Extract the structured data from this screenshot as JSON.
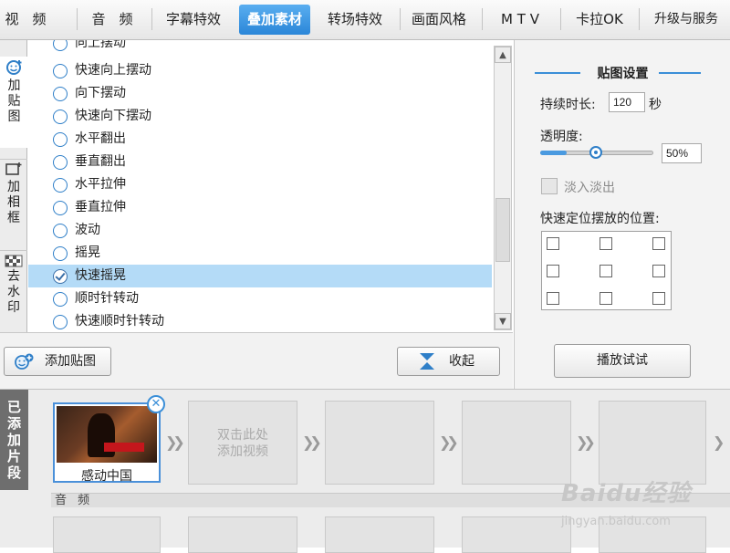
{
  "topnav": {
    "tabs": [
      {
        "label": "视　频"
      },
      {
        "label": "音　频"
      },
      {
        "label": "字幕特效"
      },
      {
        "label": "叠加素材"
      },
      {
        "label": "转场特效"
      },
      {
        "label": "画面风格"
      },
      {
        "label": "M T V"
      },
      {
        "label": "卡拉OK"
      },
      {
        "label": "升级与服务"
      }
    ],
    "active_tab": "叠加素材"
  },
  "sidebar": {
    "items": [
      {
        "label": "加贴图",
        "icon": "sticker-icon",
        "active": true
      },
      {
        "label": "加相框",
        "icon": "frame-icon",
        "active": false
      },
      {
        "label": "去水印",
        "icon": "watermark-removal-icon",
        "active": false
      }
    ]
  },
  "effects_list": {
    "items": [
      {
        "label": "向上摆动",
        "selected": false
      },
      {
        "label": "快速向上摆动",
        "selected": false
      },
      {
        "label": "向下摆动",
        "selected": false
      },
      {
        "label": "快速向下摆动",
        "selected": false
      },
      {
        "label": "水平翻出",
        "selected": false
      },
      {
        "label": "垂直翻出",
        "selected": false
      },
      {
        "label": "水平拉伸",
        "selected": false
      },
      {
        "label": "垂直拉伸",
        "selected": false
      },
      {
        "label": "波动",
        "selected": false
      },
      {
        "label": "摇晃",
        "selected": false
      },
      {
        "label": "快速摇晃",
        "selected": true
      },
      {
        "label": "顺时针转动",
        "selected": false
      },
      {
        "label": "快速顺时针转动",
        "selected": false
      }
    ]
  },
  "left_footer": {
    "add_sticker_label": "添加贴图",
    "collapse_label": "收起"
  },
  "sticker_settings": {
    "title": "贴图设置",
    "duration_label": "持续时长:",
    "duration_value": "120",
    "duration_unit": "秒",
    "opacity_label": "透明度:",
    "opacity_value": "50%",
    "opacity_level": 0.5,
    "fade_label": "淡入淡出",
    "fade_checked": false,
    "position_label": "快速定位摆放的位置:",
    "preview_label": "播放试试"
  },
  "timeline": {
    "added_tab_label": "已添加片段",
    "clips": [
      {
        "label": "感动中国"
      }
    ],
    "add_video_hint_line1": "双击此处",
    "add_video_hint_line2": "添加视频",
    "audio_label": "音 频"
  },
  "watermark": {
    "logo": "Baidu经验",
    "url": "jingyan.baidu.com"
  },
  "colors": {
    "accent": "#2a86d8",
    "selected_row": "#b4dbf7"
  }
}
